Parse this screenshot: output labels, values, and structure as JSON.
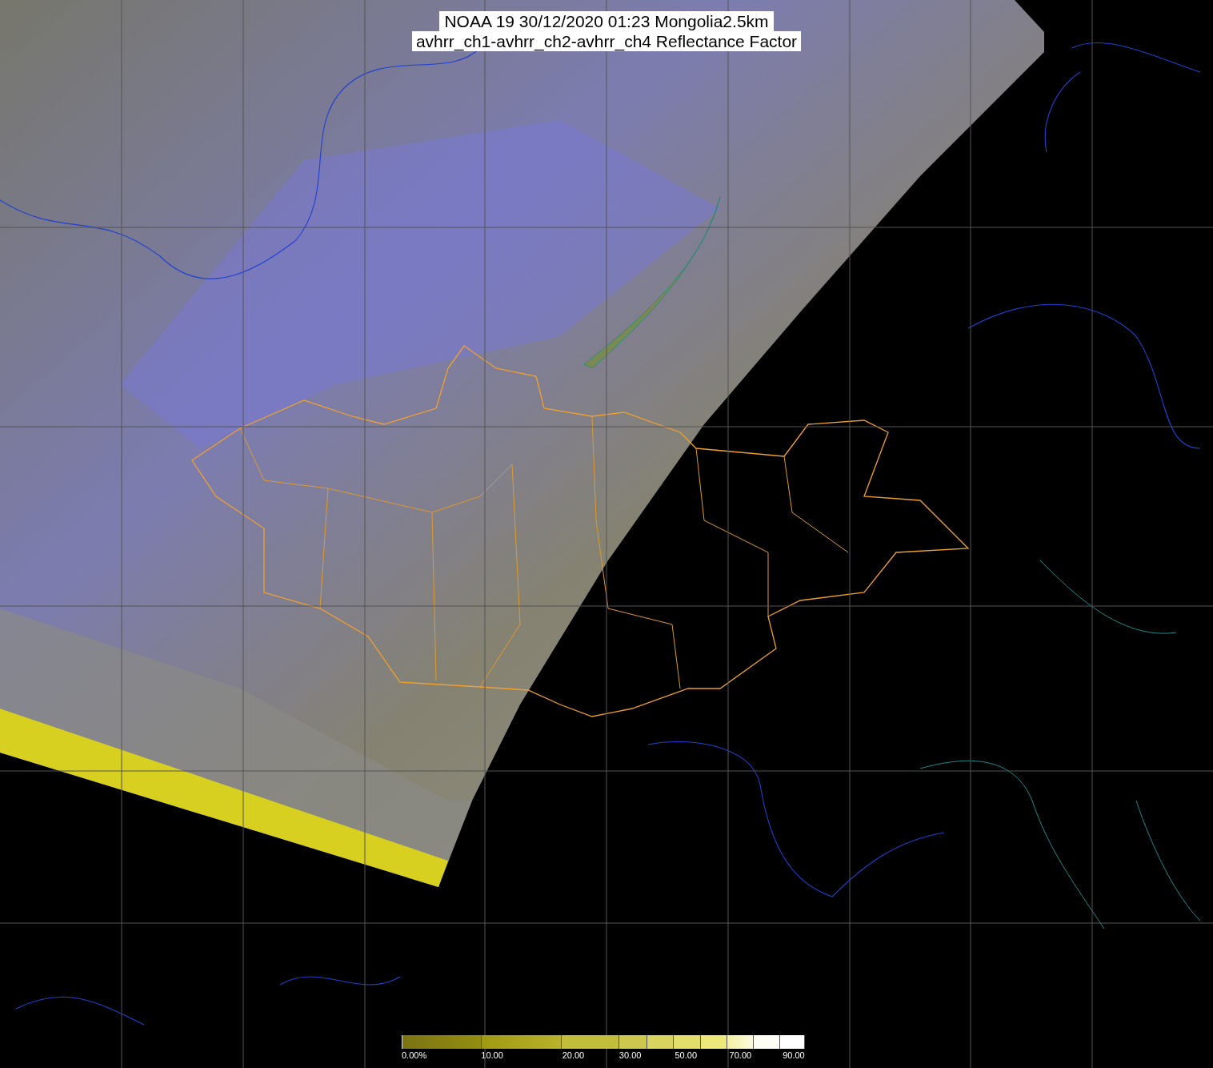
{
  "title": {
    "lines": [
      "NOAA 19 30/12/2020 01:23 Mongolia2.5km",
      "avhrr_ch1-avhrr_ch2-avhrr_ch4 Reflectance Factor"
    ]
  },
  "colorbar": {
    "labels": [
      "0.00%",
      "10.00",
      "20.00",
      "30.00",
      "50.00",
      "70.00",
      "90.00"
    ]
  }
}
